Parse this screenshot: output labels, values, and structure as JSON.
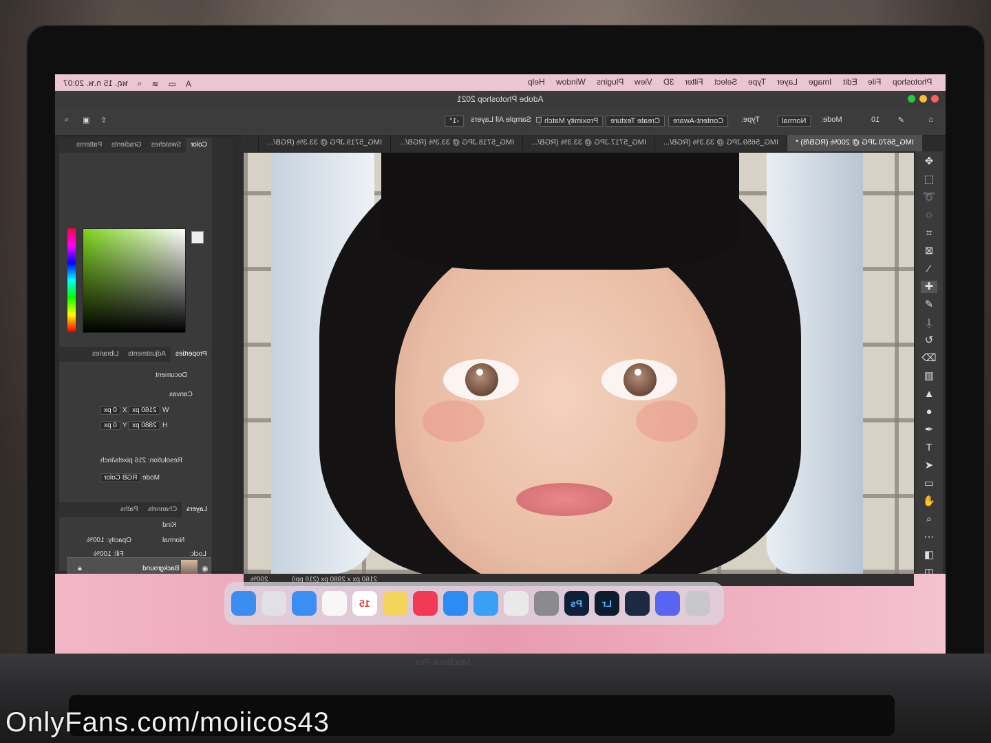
{
  "watermark": "OnlyFans.com/moiicos43",
  "laptop_label": "MacBook Pro",
  "menubar": {
    "apple": "",
    "menus": [
      "Photoshop",
      "File",
      "Edit",
      "Image",
      "Layer",
      "Type",
      "Select",
      "Filter",
      "3D",
      "View",
      "Plugins",
      "Window",
      "Help"
    ],
    "clock": "พฤ. 15 ก.พ. 20:07"
  },
  "ps_window_title": "Adobe Photoshop 2021",
  "options": {
    "mode_label": "Mode:",
    "mode_value": "Normal",
    "type_label": "Type:",
    "type_buttons": [
      "Content-Aware",
      "Create Texture",
      "Proximity Match"
    ],
    "sample_all_layers": "Sample All Layers",
    "angle_value": "-1°",
    "brush_size": "10"
  },
  "tabs": [
    {
      "label": "IMG_5670.JPG @ 200% (RGB/8) *",
      "active": true
    },
    {
      "label": "IMG_5659.JPG @ 33.3% (RGB/...",
      "active": false
    },
    {
      "label": "IMG_5717.JPG @ 33.3% (RGB/...",
      "active": false
    },
    {
      "label": "IMG_5718.JPG @ 33.3% (RGB/...",
      "active": false
    },
    {
      "label": "IMG_5719.JPG @ 33.3% (RGB/...",
      "active": false
    }
  ],
  "color_panel": {
    "tabs": [
      "Color",
      "Swatches",
      "Gradients",
      "Patterns"
    ],
    "fg_color": "#f0f0f0",
    "picker_hue": "#7dd31b"
  },
  "properties_panel": {
    "tabs": [
      "Properties",
      "Adjustments",
      "Libraries"
    ],
    "document": "Document",
    "canvas": "Canvas",
    "w_label": "W",
    "w_value": "2160 px",
    "h_label": "H",
    "h_value": "2880 px",
    "x_label": "X",
    "x_value": "0 px",
    "y_label": "Y",
    "y_value": "0 px",
    "resolution": "Resolution: 216 pixels/inch",
    "mode_label": "Mode",
    "mode_value": "RGB Color"
  },
  "layers_panel": {
    "tabs": [
      "Layers",
      "Channels",
      "Paths"
    ],
    "kind": "Kind",
    "blend": "Normal",
    "opacity": "Opacity: 100%",
    "lock": "Lock:",
    "fill": "Fill: 100%",
    "layer_name": "Background"
  },
  "status": {
    "zoom": "200%",
    "dimensions": "2160 px x 2880 px (216 ppi)"
  },
  "dock": {
    "apps": [
      {
        "icon": "finder-icon",
        "label": "",
        "color": "#3b8ef0"
      },
      {
        "icon": "launchpad-icon",
        "label": "",
        "color": "#e0e0e6"
      },
      {
        "icon": "mail-icon",
        "label": "",
        "color": "#3c8ff2"
      },
      {
        "icon": "photos-icon",
        "label": "",
        "color": "#f7f7f7"
      },
      {
        "icon": "calendar-icon",
        "label": "15",
        "color": "#ffffff"
      },
      {
        "icon": "notes-icon",
        "label": "",
        "color": "#f5d45b"
      },
      {
        "icon": "music-icon",
        "label": "",
        "color": "#f33a55"
      },
      {
        "icon": "appstore-icon",
        "label": "",
        "color": "#2b8cf3"
      },
      {
        "icon": "safari-icon",
        "label": "",
        "color": "#3aa0f5"
      },
      {
        "icon": "chrome-icon",
        "label": "",
        "color": "#e9e9e9"
      },
      {
        "icon": "system-prefs-icon",
        "label": "",
        "color": "#8a8a8e"
      },
      {
        "icon": "photoshop-icon",
        "label": "Ps",
        "color": "#0e1f37"
      },
      {
        "icon": "lightroom-icon",
        "label": "Lr",
        "color": "#0d1c2c"
      },
      {
        "icon": "steam-icon",
        "label": "",
        "color": "#1b2a42"
      },
      {
        "icon": "discord-icon",
        "label": "",
        "color": "#5865f2"
      },
      {
        "icon": "trash-icon",
        "label": "",
        "color": "#c8c8cc"
      }
    ]
  }
}
